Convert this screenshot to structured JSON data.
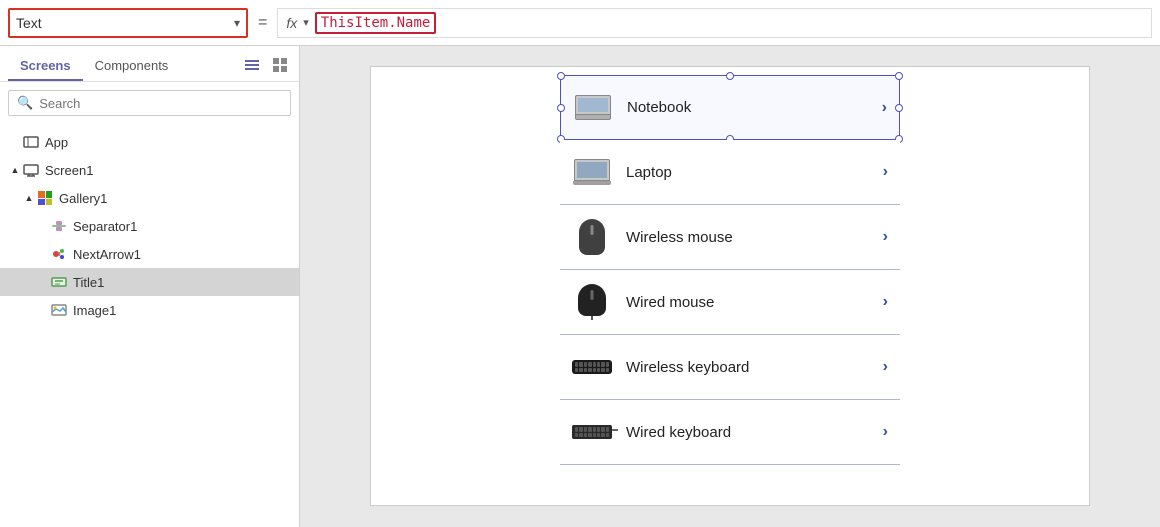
{
  "topbar": {
    "property_label": "Text",
    "formula_icon": "fx",
    "formula_text": "ThisItem.Name",
    "dropdown_icon": "▾",
    "chevron_icon": "▾",
    "equals": "="
  },
  "left_panel": {
    "tabs": [
      {
        "id": "screens",
        "label": "Screens",
        "active": true
      },
      {
        "id": "components",
        "label": "Components",
        "active": false
      }
    ],
    "search_placeholder": "Search",
    "tree": [
      {
        "id": "app",
        "label": "App",
        "level": 1,
        "expand": "",
        "icon": "app"
      },
      {
        "id": "screen1",
        "label": "Screen1",
        "level": 1,
        "expand": "▲",
        "icon": "screen"
      },
      {
        "id": "gallery1",
        "label": "Gallery1",
        "level": 2,
        "expand": "▲",
        "icon": "gallery"
      },
      {
        "id": "separator1",
        "label": "Separator1",
        "level": 3,
        "expand": "",
        "icon": "separator"
      },
      {
        "id": "nextarrow1",
        "label": "NextArrow1",
        "level": 3,
        "expand": "",
        "icon": "nextarrow"
      },
      {
        "id": "title1",
        "label": "Title1",
        "level": 3,
        "expand": "",
        "icon": "title",
        "selected": true
      },
      {
        "id": "image1",
        "label": "Image1",
        "level": 3,
        "expand": "",
        "icon": "image1"
      }
    ]
  },
  "canvas": {
    "items": [
      {
        "id": "notebook",
        "name": "Notebook",
        "img_type": "notebook",
        "selected": true
      },
      {
        "id": "laptop",
        "name": "Laptop",
        "img_type": "laptop",
        "selected": false
      },
      {
        "id": "wireless_mouse",
        "name": "Wireless mouse",
        "img_type": "mouse_wireless",
        "selected": false
      },
      {
        "id": "wired_mouse",
        "name": "Wired mouse",
        "img_type": "mouse_wired",
        "selected": false
      },
      {
        "id": "wireless_keyboard",
        "name": "Wireless keyboard",
        "img_type": "keyboard_wireless",
        "selected": false
      },
      {
        "id": "wired_keyboard",
        "name": "Wired keyboard",
        "img_type": "keyboard_wired",
        "selected": false
      }
    ],
    "arrow_label": "›"
  }
}
